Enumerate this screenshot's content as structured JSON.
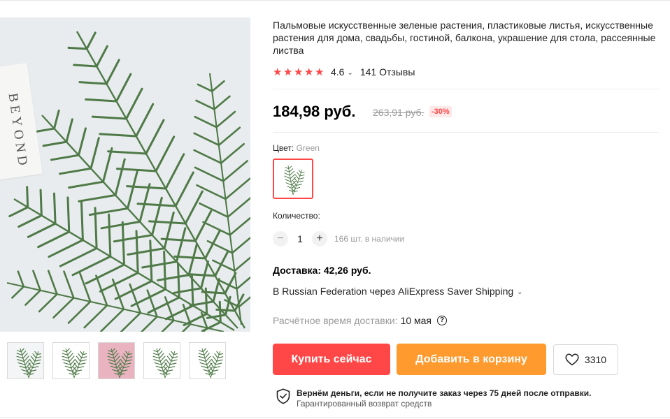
{
  "product": {
    "title": "Пальмовые искусственные зеленые растения, пластиковые листья, искусственные растения для дома, свадьбы, гостиной, балкона, украшение для стола, рассеянные листва",
    "rating_value": "4.6",
    "reviews": "141 Отзывы",
    "price": "184,98 руб.",
    "old_price": "263,91 руб.",
    "discount": "-30%"
  },
  "gallery": {
    "book_text": "BEYOND",
    "thumbnails": [
      "thumbnail-1",
      "thumbnail-2",
      "thumbnail-3",
      "thumbnail-4",
      "thumbnail-5"
    ]
  },
  "options": {
    "color_label": "Цвет:",
    "color_value": "Green"
  },
  "quantity": {
    "label": "Количество:",
    "minus": "−",
    "value": "1",
    "plus": "+",
    "stock": "166 шт. в наличии"
  },
  "delivery": {
    "cost": "Доставка: 42,26 руб.",
    "method": "В Russian Federation через AliExpress Saver Shipping",
    "eta_label": "Расчётное время доставки:",
    "eta_date": "10 мая",
    "help": "?"
  },
  "actions": {
    "buy": "Купить сейчас",
    "cart": "Добавить в корзину",
    "wishlist_count": "3310"
  },
  "guarantee": {
    "title": "Вернём деньги, если не получите заказ через 75 дней после отправки.",
    "subtitle": "Гарантированный возврат средств"
  },
  "icons": {
    "star": "★",
    "chevron": "⌄",
    "heart": "heart-icon",
    "shield": "shield-check-icon"
  },
  "colors": {
    "accent_red": "#ff4747",
    "accent_orange": "#ff9a2e",
    "leaf_green": "#4f7a48"
  }
}
